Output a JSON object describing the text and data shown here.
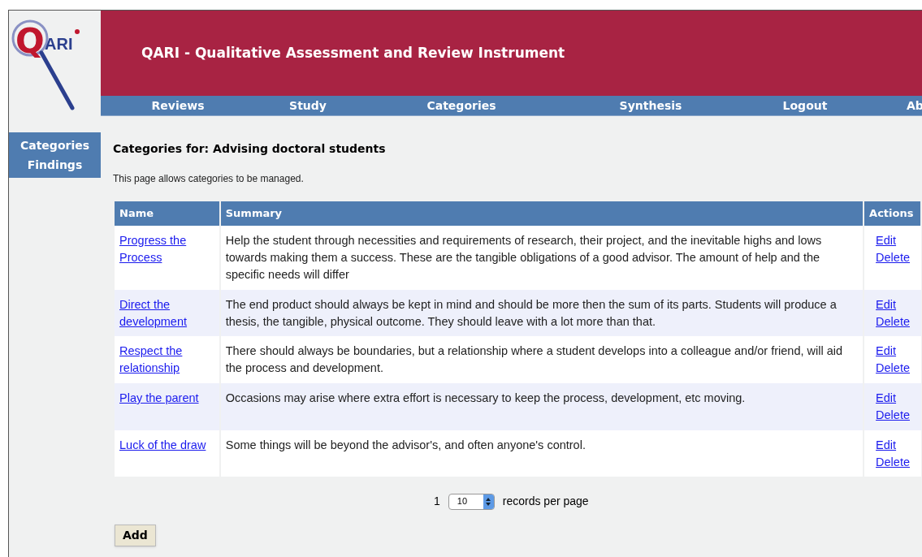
{
  "logo": {
    "letter": "Q",
    "rest": "ARI"
  },
  "header": {
    "title": "QARI - Qualitative Assessment and Review Instrument"
  },
  "nav": [
    {
      "label": "Reviews"
    },
    {
      "label": "Study"
    },
    {
      "label": "Categories"
    },
    {
      "label": "Synthesis"
    },
    {
      "label": "Logout"
    },
    {
      "label": "Ab"
    }
  ],
  "sidebar": {
    "items": [
      {
        "label": "Categories"
      },
      {
        "label": "Findings"
      }
    ]
  },
  "page": {
    "heading": "Categories for: Advising doctoral students",
    "description": "This page allows categories to be managed."
  },
  "table": {
    "columns": [
      "Name",
      "Summary",
      "Actions"
    ],
    "rows": [
      {
        "name": "Progress the Process",
        "summary": "Help the student through necessities and requirements of research, their project, and the inevitable highs and lows towards making them a success. These are the tangible obligations of a good advisor. The amount of help and the specific needs will differ",
        "actions": [
          "Edit",
          "Delete"
        ]
      },
      {
        "name": "Direct the development",
        "summary": "The end product should always be kept in mind and should be more then the sum of its parts. Students will produce a thesis, the tangible, physical outcome. They should leave with a lot more than that.",
        "actions": [
          "Edit",
          "Delete"
        ]
      },
      {
        "name": "Respect the relationship",
        "summary": "There should always be boundaries, but a relationship where a student develops into a colleague and/or friend, will aid the process and development.",
        "actions": [
          "Edit",
          "Delete"
        ]
      },
      {
        "name": "Play the parent",
        "summary": "Occasions may arise where extra effort is necessary to keep the process, development, etc moving.",
        "actions": [
          "Edit",
          "Delete"
        ]
      },
      {
        "name": "Luck of the draw",
        "summary": "Some things will be beyond the advisor's, and often anyone's control.",
        "actions": [
          "Edit",
          "Delete"
        ]
      }
    ]
  },
  "pagination": {
    "page": "1",
    "per_page": "10",
    "label": "records per page"
  },
  "buttons": [
    "Add"
  ]
}
